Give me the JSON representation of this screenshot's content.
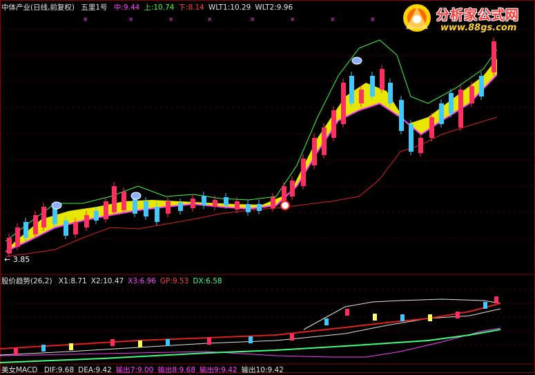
{
  "main_panel": {
    "indicator_name": "中体产业(日线,前复权)",
    "indicator_sub": "五里1号",
    "labels": [
      {
        "text": "中:9.44",
        "color": "#ff40ff"
      },
      {
        "text": "上:10.74",
        "color": "#40ff40"
      },
      {
        "text": "下:8.14",
        "color": "#ff4040"
      },
      {
        "text": "WLT1:10.29",
        "color": "#e6e6e6"
      },
      {
        "text": "WLT2:9.96",
        "color": "#e6e6e6"
      }
    ],
    "low_marker": "← 3.85"
  },
  "trend_panel": {
    "indicator_name": "股价趋势(26,2)",
    "labels": [
      {
        "text": "X1:8.71",
        "color": "#e6e6e6"
      },
      {
        "text": "X2:10.47",
        "color": "#e6e6e6"
      },
      {
        "text": "X3:6.96",
        "color": "#ff40ff"
      },
      {
        "text": "GP:9.53",
        "color": "#ff4040"
      },
      {
        "text": "DX:6.58",
        "color": "#40ff80"
      }
    ]
  },
  "macd_panel": {
    "indicator_name": "美女MACD",
    "labels": [
      {
        "text": "DIF:9.68",
        "color": "#e6e6e6"
      },
      {
        "text": "DEA:9.42",
        "color": "#e6e6e6"
      },
      {
        "text": "输出7:9.00",
        "color": "#ff40ff"
      },
      {
        "text": "输出8:9.68",
        "color": "#ff40ff"
      },
      {
        "text": "输出9:9.42",
        "color": "#ff40ff"
      },
      {
        "text": "输出10:9.42",
        "color": "#e6e6e6"
      }
    ]
  },
  "watermark": {
    "name": "分析家公式网",
    "url": "www.88gs.com"
  },
  "colors": {
    "up": "#ff3060",
    "down": "#40c8ff",
    "mid": "#ff40ff",
    "upper": "#40ff40",
    "lower": "#e02020",
    "fill": "#ffff00",
    "grid": "#8a0000"
  }
}
